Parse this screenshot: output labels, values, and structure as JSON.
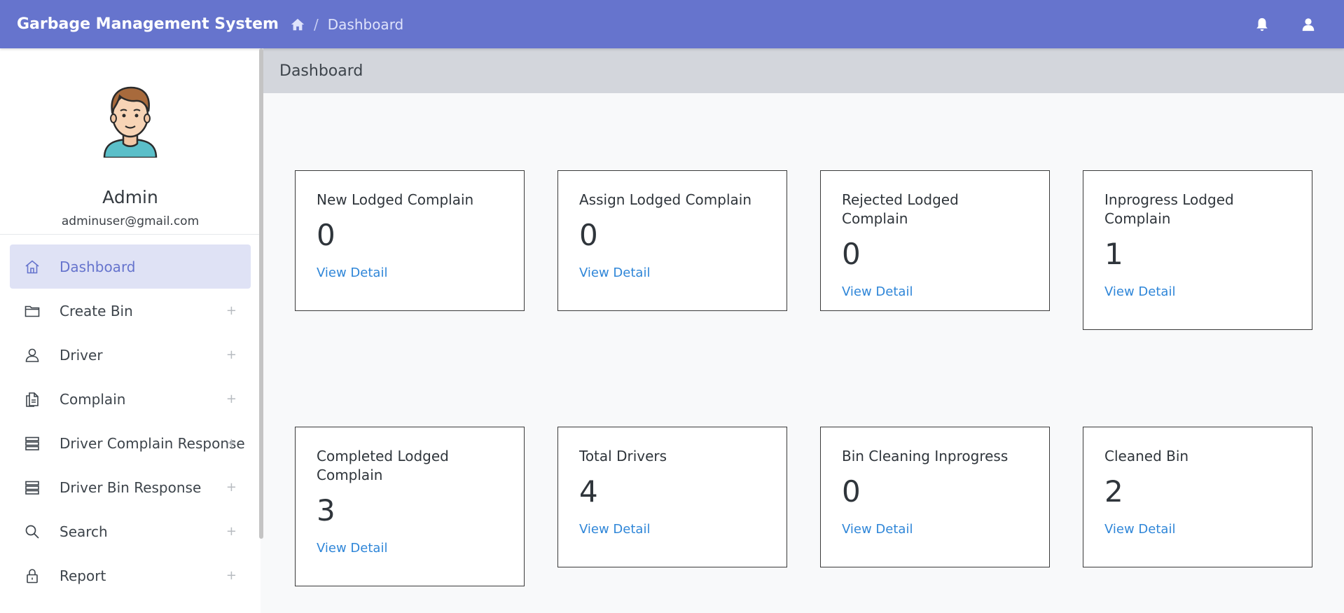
{
  "app": {
    "brand": "Garbage Management System"
  },
  "breadcrumb": {
    "current": "Dashboard"
  },
  "profile": {
    "name": "Admin",
    "email": "adminuser@gmail.com"
  },
  "sidebar": {
    "items": [
      {
        "label": "Dashboard",
        "icon": "home-icon",
        "active": true
      },
      {
        "label": "Create Bin",
        "icon": "folder-icon",
        "expand": "+"
      },
      {
        "label": "Driver",
        "icon": "user-icon",
        "expand": "+"
      },
      {
        "label": "Complain",
        "icon": "documents-icon",
        "expand": "+"
      },
      {
        "label": "Driver Complain Response",
        "icon": "server-icon",
        "expand": "+"
      },
      {
        "label": "Driver Bin Response",
        "icon": "server-icon",
        "expand": "+"
      },
      {
        "label": "Search",
        "icon": "search-icon",
        "expand": "+"
      },
      {
        "label": "Report",
        "icon": "lock-icon",
        "expand": "+"
      }
    ]
  },
  "main": {
    "title": "Dashboard",
    "cards": [
      {
        "title": "New Lodged Complain",
        "value": "0",
        "link": "View Detail"
      },
      {
        "title": "Assign Lodged Complain",
        "value": "0",
        "link": "View Detail"
      },
      {
        "title": "Rejected Lodged Complain",
        "value": "0",
        "link": "View Detail"
      },
      {
        "title": "Inprogress Lodged Complain",
        "value": "1",
        "link": "View Detail"
      },
      {
        "title": "Completed Lodged Complain",
        "value": "3",
        "link": "View Detail"
      },
      {
        "title": "Total Drivers",
        "value": "4",
        "link": "View Detail"
      },
      {
        "title": "Bin Cleaning Inprogress",
        "value": "0",
        "link": "View Detail"
      },
      {
        "title": "Cleaned Bin",
        "value": "2",
        "link": "View Detail"
      }
    ]
  },
  "colors": {
    "topbar": "#6674cd",
    "active_bg": "#dfe2f5",
    "link": "#2f86d8",
    "page_header": "#d3d6dc"
  }
}
